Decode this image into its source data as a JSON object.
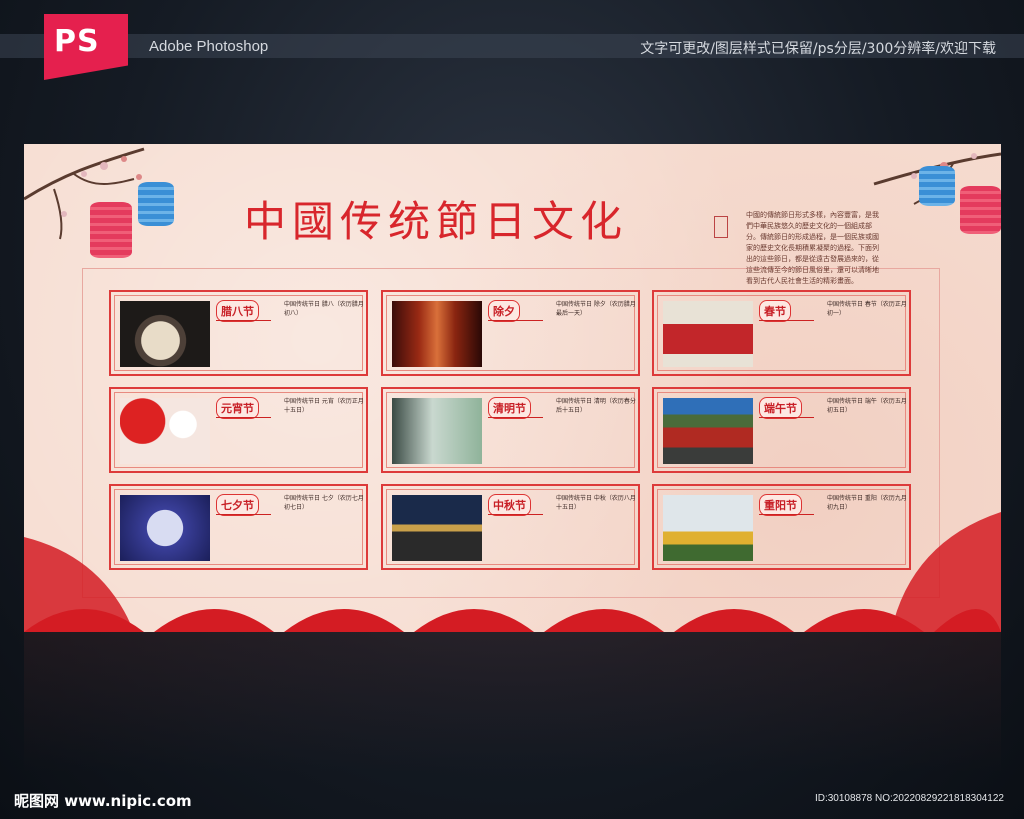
{
  "header": {
    "badge": "PS",
    "app_name": "Adobe Photoshop",
    "note": "文字可更改/图层样式已保留/ps分层/300分辨率/欢迎下载"
  },
  "board": {
    "title": "中國传统節日文化",
    "intro": "中國的傳統節日形式多樣，內容豐富，是我們中華民族悠久的歷史文化的一個組成部分。傳統節日的形成過程，是一個民族或國家的歷史文化長期積累凝聚的過程。下面列出的這些節日，都是從遠古發展過來的，從這些流傳至今的節日風俗里，還可以清晰地看到古代人民社會生活的精彩畫面。",
    "cards": [
      {
        "name": "腊八节",
        "text": "中国传统节日 腊八（农历腊月初八）"
      },
      {
        "name": "除夕",
        "text": "中国传统节日 除夕（农历腊月最后一天）"
      },
      {
        "name": "春节",
        "text": "中国传统节日 春节（农历正月初一）"
      },
      {
        "name": "元宵节",
        "text": "中国传统节日 元宵（农历正月十五日）"
      },
      {
        "name": "清明节",
        "text": "中国传统节日 清明（农历春分后十五日）"
      },
      {
        "name": "端午节",
        "text": "中国传统节日 端午（农历五月初五日）"
      },
      {
        "name": "七夕节",
        "text": "中国传统节日 七夕（农历七月初七日）"
      },
      {
        "name": "中秋节",
        "text": "中国传统节日 中秋（农历八月十五日）"
      },
      {
        "name": "重阳节",
        "text": "中国传统节日 重阳（农历九月初九日）"
      }
    ]
  },
  "footer": {
    "site": "昵图网 www.nipic.com",
    "id": "ID:30108878 NO:20220829221818304122"
  },
  "colors": {
    "accent": "#d8262c",
    "board_bg": "#f6dcd0",
    "card_border": "#dd3a3a",
    "page_bg": "#151b24"
  }
}
